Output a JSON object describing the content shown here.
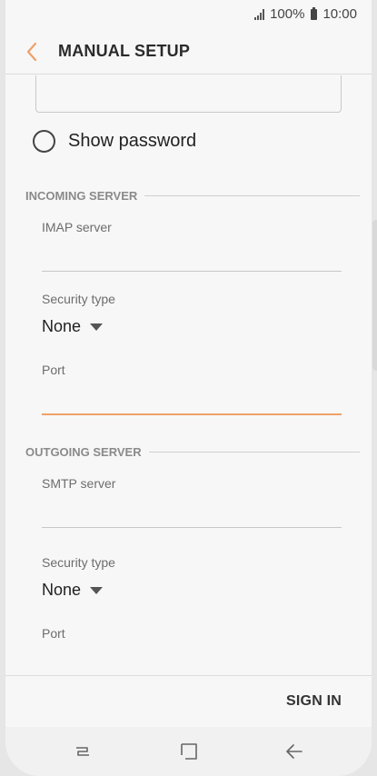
{
  "status_bar": {
    "battery_pct": "100%",
    "time": "10:00",
    "icons": [
      "signal-icon",
      "battery-icon"
    ]
  },
  "app_bar": {
    "title": "MANUAL SETUP",
    "back_icon": "chevron-left-icon"
  },
  "password": {
    "value": "",
    "show_password_label": "Show password",
    "show_password_checked": false
  },
  "incoming": {
    "header": "INCOMING SERVER",
    "server_label": "IMAP server",
    "server_value": "",
    "security_label": "Security type",
    "security_value": "None",
    "port_label": "Port",
    "port_value": ""
  },
  "outgoing": {
    "header": "OUTGOING SERVER",
    "server_label": "SMTP server",
    "server_value": "",
    "security_label": "Security type",
    "security_value": "None",
    "port_label": "Port"
  },
  "actions": {
    "sign_in": "SIGN IN"
  },
  "nav_bar": {
    "icons": [
      "recents-icon",
      "home-icon",
      "back-arrow-icon"
    ]
  },
  "colors": {
    "accent": "#f0a069",
    "background": "#f7f7f7",
    "text": "#222222"
  }
}
